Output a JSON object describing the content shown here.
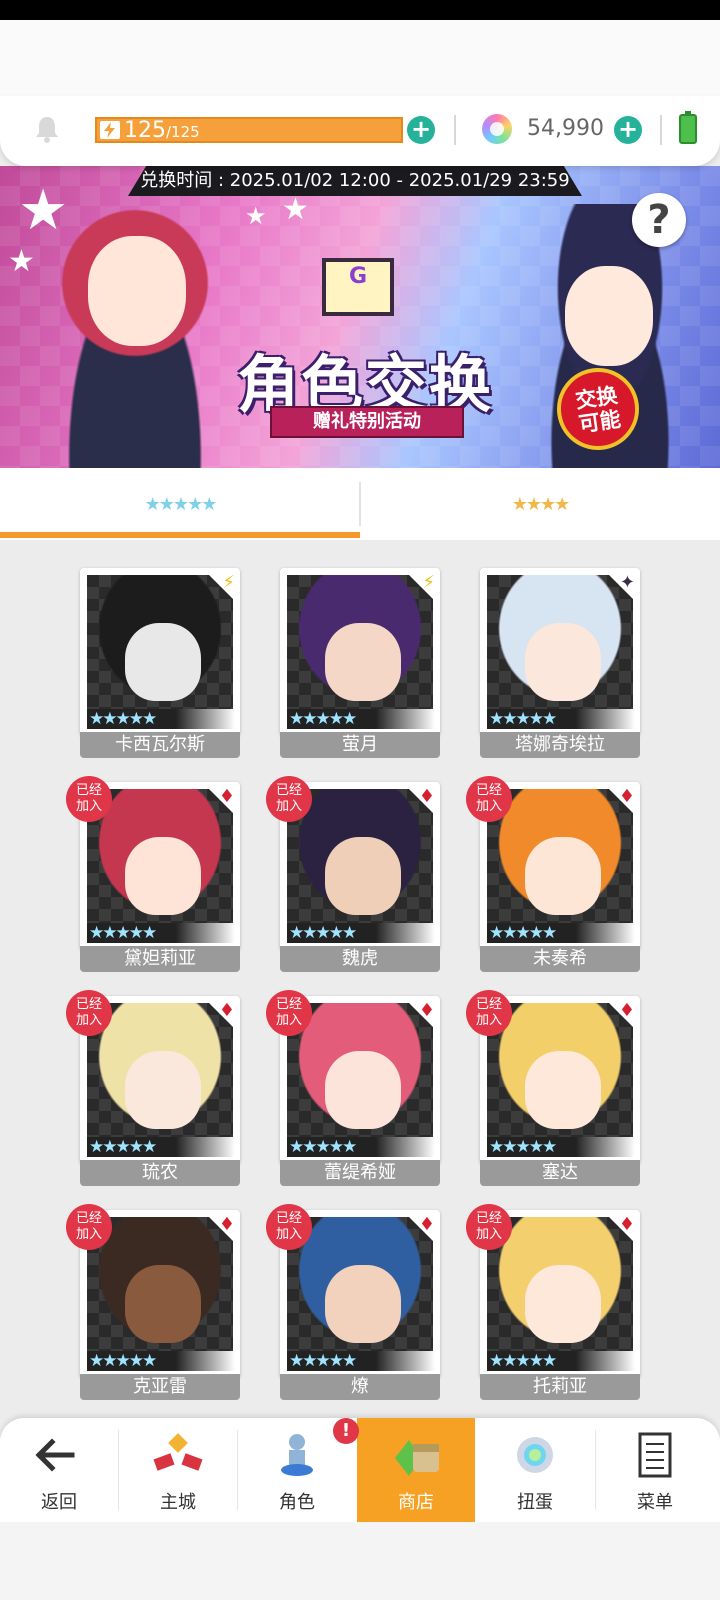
{
  "hud": {
    "energy_current": "125",
    "energy_max": "/125",
    "energy_progress": 1.0,
    "gems": "54,990"
  },
  "banner": {
    "period": "兑换时间 : 2025.01/02 12:00 - 2025.01/29 23:59",
    "title": "角色交换",
    "subtitle": "赠礼特别活动",
    "badge_line1": "交换",
    "badge_line2": "可能",
    "help": "?"
  },
  "tabs": [
    {
      "stars": "★★★★★",
      "rarity": 5,
      "selected": true
    },
    {
      "stars": "★★★★",
      "rarity": 4,
      "selected": false
    }
  ],
  "cards": [
    {
      "name": "卡西瓦尔斯",
      "joined": false,
      "type_icon": "lightning-icon",
      "hair": "#1c1c1c",
      "face": "#e8e8e8"
    },
    {
      "name": "萤月",
      "joined": false,
      "type_icon": "lightning-icon",
      "hair": "#4a2a6e",
      "face": "#f5d7c8"
    },
    {
      "name": "塔娜奇埃拉",
      "joined": false,
      "type_icon": "dark-star-icon",
      "hair": "#d7e4f2",
      "face": "#fbe7dc"
    },
    {
      "name": "黛妲莉亚",
      "joined": true,
      "type_icon": "red-suit-icon",
      "hair": "#c5364f",
      "face": "#fde4d6"
    },
    {
      "name": "魏虎",
      "joined": true,
      "type_icon": "red-suit-icon",
      "hair": "#2a2240",
      "face": "#f0cfb8"
    },
    {
      "name": "未奏希",
      "joined": true,
      "type_icon": "red-suit-icon",
      "hair": "#f08a2a",
      "face": "#fde6d6"
    },
    {
      "name": "琉农",
      "joined": true,
      "type_icon": "red-suit-icon",
      "hair": "#efe2a6",
      "face": "#fbe8dc"
    },
    {
      "name": "蕾缇希娅",
      "joined": true,
      "type_icon": "red-suit-icon",
      "hair": "#e35c7a",
      "face": "#fde4da"
    },
    {
      "name": "塞达",
      "joined": true,
      "type_icon": "red-suit-icon",
      "hair": "#f3cf6a",
      "face": "#fde8da"
    },
    {
      "name": "克亚雷",
      "joined": true,
      "type_icon": "red-suit-icon",
      "hair": "#3b2a22",
      "face": "#8a5a3e"
    },
    {
      "name": "燎",
      "joined": true,
      "type_icon": "red-suit-icon",
      "hair": "#2f5fa0",
      "face": "#f3d2bd"
    },
    {
      "name": "托莉亚",
      "joined": true,
      "type_icon": "red-suit-icon",
      "hair": "#f4cf6e",
      "face": "#fde8da"
    }
  ],
  "card_stars": "★★★★★",
  "joined_label_line1": "已经",
  "joined_label_line2": "加入",
  "nav": {
    "back": "返回",
    "main_city": "主城",
    "character": "角色",
    "shop": "商店",
    "gacha": "扭蛋",
    "menu": "菜单",
    "character_alert": "!"
  },
  "colors": {
    "accent_orange": "#f6a024",
    "teal_plus": "#26b29a",
    "joined_red": "#e03648"
  }
}
